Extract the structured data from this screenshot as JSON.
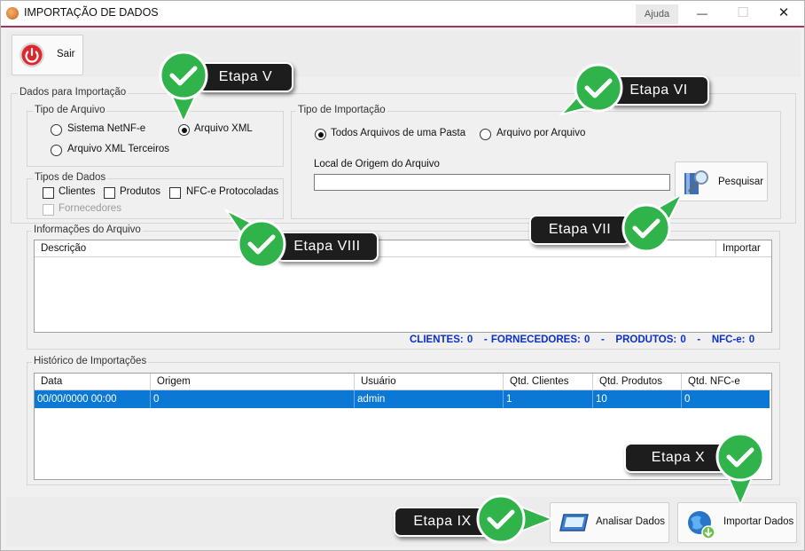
{
  "window": {
    "title": "IMPORTAÇÃO DE DADOS",
    "help_label": "Ajuda",
    "minimize_glyph": "—",
    "maximize_glyph": "☐",
    "close_glyph": "✕"
  },
  "toolbar": {
    "exit_label": "Sair"
  },
  "import_data": {
    "legend": "Dados para Importação",
    "file_type": {
      "legend": "Tipo de Arquivo",
      "options": [
        {
          "label": "Sistema NetNF-e",
          "selected": false
        },
        {
          "label": "Arquivo XML",
          "selected": true
        },
        {
          "label": "Arquivo XML Terceiros",
          "selected": false
        }
      ]
    },
    "data_types": {
      "legend": "Tipos de Dados",
      "options": [
        {
          "label": "Clientes",
          "checked": false,
          "enabled": true
        },
        {
          "label": "Produtos",
          "checked": false,
          "enabled": true
        },
        {
          "label": "NFC-e Protocoladas",
          "checked": false,
          "enabled": true
        },
        {
          "label": "Fornecedores",
          "checked": false,
          "enabled": false
        }
      ]
    },
    "import_type": {
      "legend": "Tipo de Importação",
      "options": [
        {
          "label": "Todos Arquivos de uma Pasta",
          "selected": true
        },
        {
          "label": "Arquivo por Arquivo",
          "selected": false
        }
      ],
      "source_label": "Local de Origem do Arquivo",
      "source_value": "",
      "search_label": "Pesquisar"
    }
  },
  "file_info": {
    "legend": "Informações do Arquivo",
    "columns": [
      "Descrição",
      "Importar"
    ],
    "totals": "CLIENTES: 0   - FORNECEDORES: 0   -   PRODUTOS: 0   -   NFC-e: 0"
  },
  "history": {
    "legend": "Histórico de Importações",
    "columns": [
      "Data",
      "Origem",
      "Usuário",
      "Qtd. Clientes",
      "Qtd. Produtos",
      "Qtd. NFC-e"
    ],
    "rows": [
      [
        "00/00/0000 00:00",
        "0",
        "admin",
        "1",
        "10",
        "0"
      ]
    ]
  },
  "actions": {
    "analyze_label": "Analisar Dados",
    "import_label": "Importar Dados"
  },
  "callouts": {
    "step5": "Etapa V",
    "step6": "Etapa VI",
    "step7": "Etapa VII",
    "step8": "Etapa VIII",
    "step9": "Etapa IX",
    "step10": "Etapa X"
  },
  "colors": {
    "title_accent": "#a7335a",
    "selection": "#0a78d4",
    "totals_text": "#0a2fcf",
    "marker_green": "#2fb34a"
  },
  "icons": {
    "app": "app-logo-icon",
    "exit": "power-icon",
    "search": "magnifier-book-icon",
    "analyze": "monitor-icon",
    "import": "globe-download-icon",
    "step_marker": "check-pin-icon"
  }
}
